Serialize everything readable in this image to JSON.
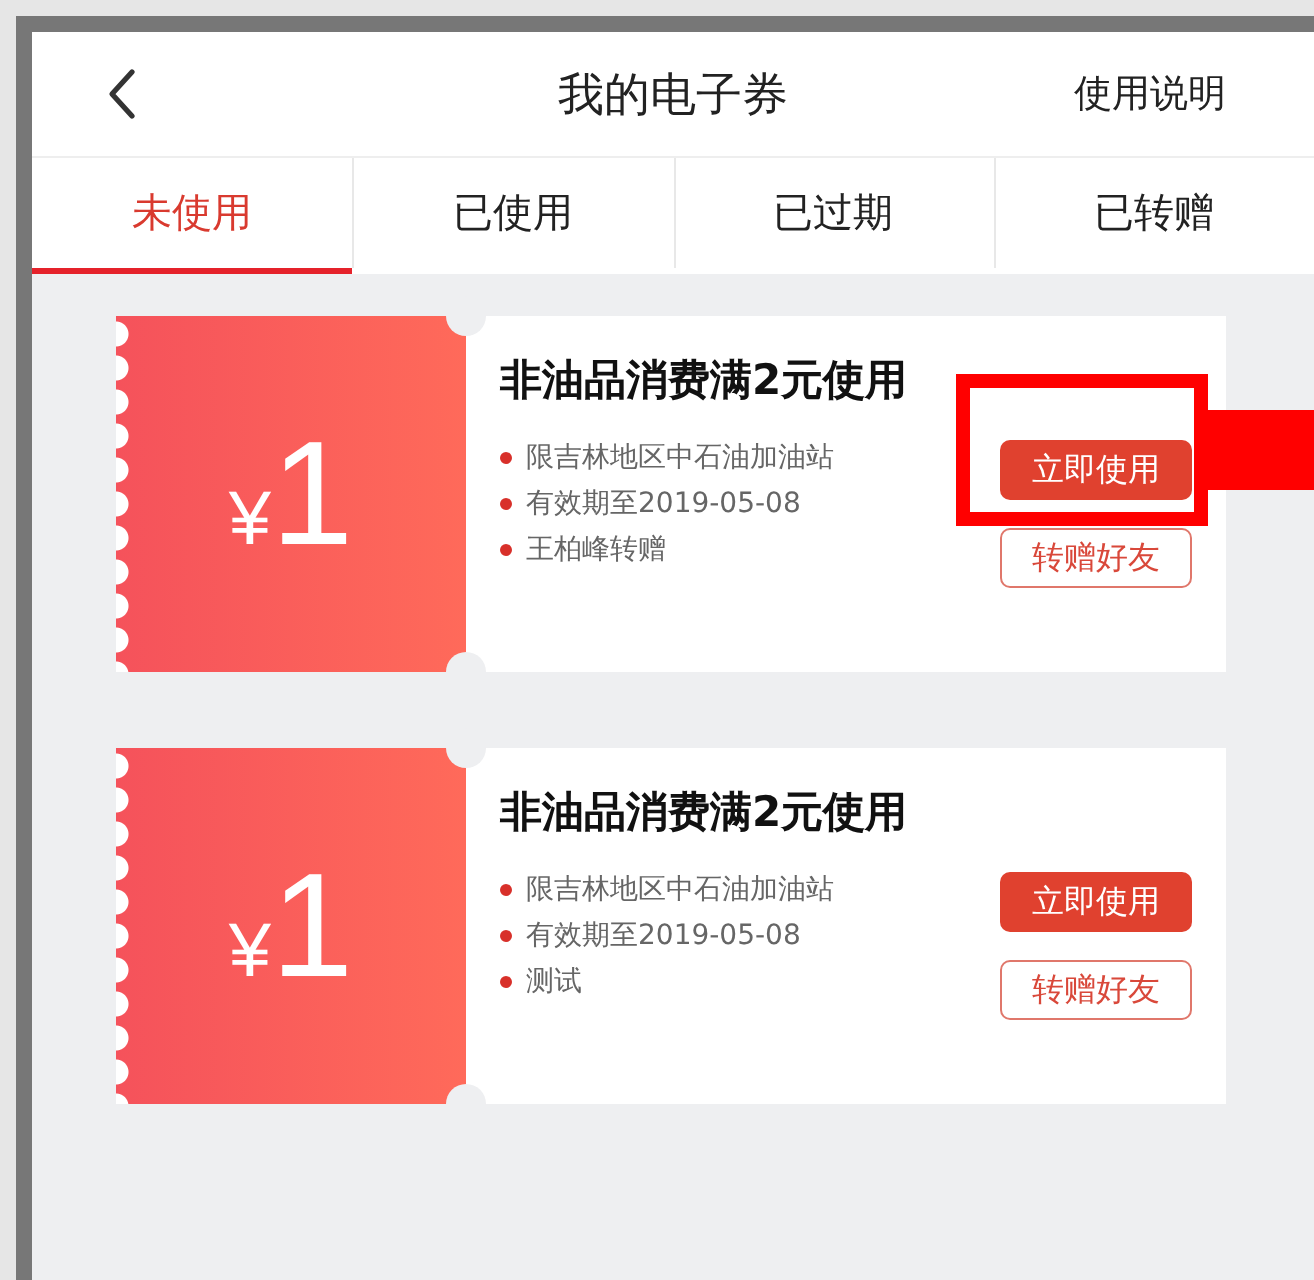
{
  "header": {
    "title": "我的电子券",
    "help_link": "使用说明"
  },
  "tabs": [
    {
      "label": "未使用",
      "selected": true
    },
    {
      "label": "已使用",
      "selected": false
    },
    {
      "label": "已过期",
      "selected": false
    },
    {
      "label": "已转赠",
      "selected": false
    }
  ],
  "coupons": [
    {
      "currency": "¥",
      "amount": "1",
      "title": "非油品消费满2元使用",
      "details": [
        "限吉林地区中石油加油站",
        "有效期至2019-05-08",
        "王柏峰转赠"
      ],
      "use_button": "立即使用",
      "gift_button": "转赠好友",
      "highlighted": true
    },
    {
      "currency": "¥",
      "amount": "1",
      "title": "非油品消费满2元使用",
      "details": [
        "限吉林地区中石油加油站",
        "有效期至2019-05-08",
        "测试"
      ],
      "use_button": "立即使用",
      "gift_button": "转赠好友",
      "highlighted": false
    }
  ]
}
